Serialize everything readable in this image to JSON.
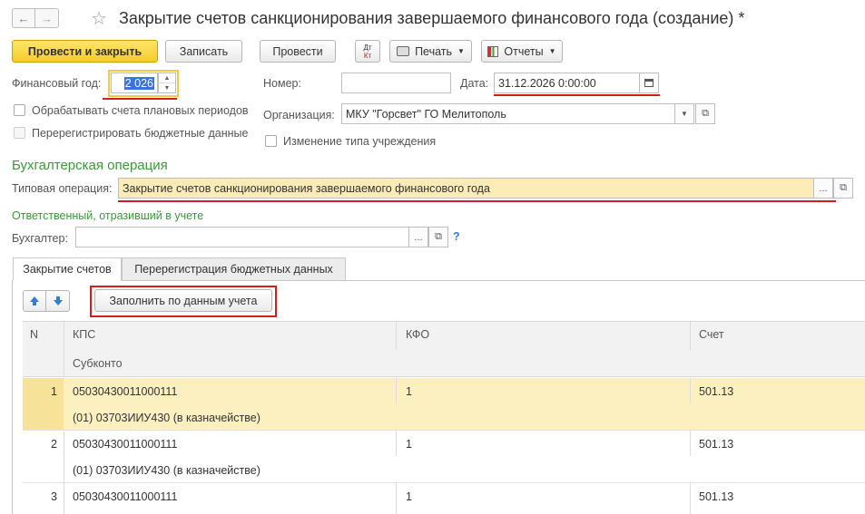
{
  "window": {
    "title": "Закрытие счетов санкционирования завершаемого финансового года (создание) *",
    "back_icon": "←",
    "forward_icon": "→",
    "star_icon": "☆"
  },
  "toolbar": {
    "post_and_close": "Провести и закрыть",
    "save": "Записать",
    "post": "Провести",
    "dtkt_top": "Дт",
    "dtkt_bottom": "Кт",
    "print": "Печать",
    "reports": "Отчеты"
  },
  "form": {
    "fiscal_year_label": "Финансовый год:",
    "fiscal_year_value": "2 026",
    "number_label": "Номер:",
    "number_value": "",
    "date_label": "Дата:",
    "date_value": "31.12.2026  0:00:00",
    "process_planned_label": "Обрабатывать счета плановых периодов",
    "reregister_label": "Перерегистрировать бюджетные данные",
    "organization_label": "Организация:",
    "organization_value": "МКУ \"Горсвет\" ГО Мелитополь",
    "type_change_label": "Изменение типа учреждения"
  },
  "operation": {
    "section_title": "Бухгалтерская операция",
    "typical_label": "Типовая операция:",
    "typical_value": "Закрытие счетов санкционирования завершаемого финансового года",
    "responsible_title": "Ответственный, отразивший в учете",
    "accountant_label": "Бухгалтер:",
    "accountant_value": "",
    "help": "?"
  },
  "tabs": [
    {
      "label": "Закрытие счетов"
    },
    {
      "label": "Перерегистрация бюджетных данных"
    }
  ],
  "table": {
    "fill_button": "Заполнить по данным учета",
    "columns": {
      "n": "N",
      "kps": "КПС",
      "kfo": "КФО",
      "account": "Счет",
      "subconto": "Субконто"
    },
    "rows": [
      {
        "n": "1",
        "kps": "05030430011000111",
        "kfo": "1",
        "account": "501.13",
        "subconto": "(01) 03703ИИУ430 (в казначействе)"
      },
      {
        "n": "2",
        "kps": "05030430011000111",
        "kfo": "1",
        "account": "501.13",
        "subconto": "(01) 03703ИИУ430 (в казначействе)"
      },
      {
        "n": "3",
        "kps": "05030430011000111",
        "kfo": "1",
        "account": "501.13",
        "subconto": ""
      }
    ]
  },
  "colors": {
    "accent_yellow": "#f5cc29",
    "selected_row": "#fdf0c0",
    "highlight_field": "#fdebb8",
    "red_mark": "#d01d1d",
    "section_green": "#3a9a3a"
  }
}
